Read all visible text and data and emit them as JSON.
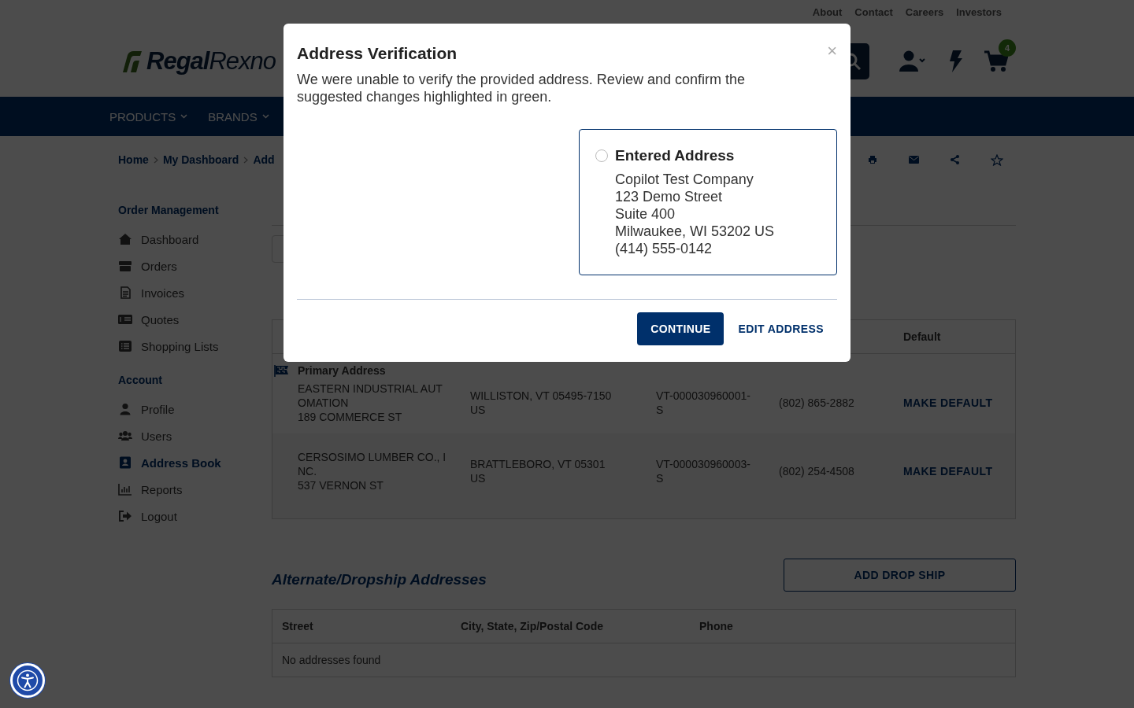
{
  "top_links": [
    {
      "label": "About"
    },
    {
      "label": "Contact"
    },
    {
      "label": "Careers"
    },
    {
      "label": "Investors"
    }
  ],
  "header": {
    "logo_bold": "Regal",
    "logo_light": "Rexno",
    "cart_count": "4"
  },
  "nav": [
    {
      "label": "PRODUCTS"
    },
    {
      "label": "BRANDS"
    }
  ],
  "breadcrumb": [
    "Home",
    "My Dashboard",
    "Add"
  ],
  "sidebar": [
    {
      "title": "Order Management",
      "items": [
        {
          "label": "Dashboard",
          "selected": false
        },
        {
          "label": "Orders",
          "selected": false
        },
        {
          "label": "Invoices",
          "selected": false
        },
        {
          "label": "Quotes",
          "selected": false
        },
        {
          "label": "Shopping Lists",
          "selected": false
        }
      ]
    },
    {
      "title": "Account",
      "items": [
        {
          "label": "Profile",
          "selected": false
        },
        {
          "label": "Users",
          "selected": false
        },
        {
          "label": "Address Book",
          "selected": true
        },
        {
          "label": "Reports",
          "selected": false
        },
        {
          "label": "Logout",
          "selected": false
        }
      ]
    }
  ],
  "addresses_table": {
    "columns": [
      "Default"
    ],
    "rows": [
      {
        "group_label": "Primary Address",
        "street": "EASTERN INDUSTRIAL AUT\nOMATION\n189 COMMERCE ST",
        "city": "WILLISTON, VT 05495-7150\nUS",
        "account": "VT-000030960001-\nS",
        "phone": "(802) 865-2882",
        "action": "MAKE DEFAULT"
      },
      {
        "street": "CERSOSIMO LUMBER CO., I\nNC.\n537 VERNON ST",
        "city": "BRATTLEBORO, VT 05301\nUS",
        "account": "VT-000030960003-\nS",
        "phone": "(802) 254-4508",
        "action": "MAKE DEFAULT"
      }
    ]
  },
  "alternate": {
    "title": "Alternate/Dropship Addresses",
    "button": "ADD DROP SHIP",
    "columns": [
      "Street",
      "City, State, Zip/Postal Code",
      "Phone"
    ],
    "empty": "No addresses found"
  },
  "modal": {
    "title": "Address Verification",
    "close": "×",
    "message": "We were unable to verify the provided address. Review and confirm the suggested changes highlighted in green.",
    "options": [
      {
        "kind": "entered",
        "title": "Entered Address",
        "lines": "Copilot Test Company\n123 Demo Street\nSuite 400\nMilwaukee, WI 53202 US\n(414) 555-0142",
        "selected": false
      }
    ],
    "buttons": [
      {
        "label": "CONTINUE",
        "kind": "primary"
      },
      {
        "label": "EDIT ADDRESS",
        "kind": "link"
      }
    ]
  }
}
